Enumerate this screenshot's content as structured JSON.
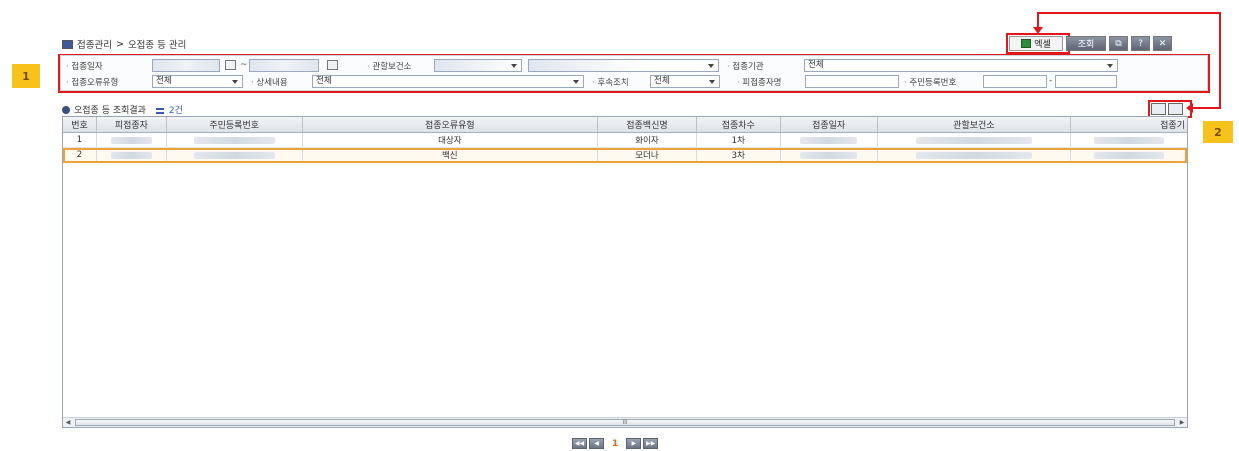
{
  "callouts": {
    "one": "1",
    "two": "2"
  },
  "breadcrumb": {
    "root": "접종관리",
    "separator": ">",
    "current": "오접종 등 관리"
  },
  "toolbar": {
    "excel_label": "엑셀",
    "search_label": "조회",
    "help_label": "?",
    "close_label": "✕",
    "popup_label": "⧉"
  },
  "filters": {
    "vaccination_date_label": "접종일자",
    "date_separator": "~",
    "health_center_label": "관할보건소",
    "institution_label": "접종기관",
    "institution_value": "전체",
    "error_type_label": "접종오류유형",
    "error_type_value": "전체",
    "detail_label": "상세내용",
    "detail_value": "전체",
    "followup_label": "후속조치",
    "followup_value": "전체",
    "recipient_label": "피접종자명",
    "rrn_label": "주민등록번호",
    "rrn_separator": "-"
  },
  "result": {
    "title": "오접종 등 조회결과",
    "count": "2건"
  },
  "grid": {
    "columns": [
      "번호",
      "피접종자",
      "주민등록번호",
      "접종오류유형",
      "접종백신명",
      "접종차수",
      "접종일자",
      "관할보건소",
      "접종기"
    ],
    "rows": [
      {
        "no": "1",
        "error_type": "대상자",
        "vaccine": "화이자",
        "dose": "1차"
      },
      {
        "no": "2",
        "error_type": "백신",
        "vaccine": "모더나",
        "dose": "3차"
      }
    ],
    "scroll_label": "III"
  },
  "pager": {
    "first": "◀◀",
    "prev": "◀",
    "page": "1",
    "next": "▶",
    "last": "▶▶"
  },
  "colors": {
    "callout": "#f7c21a",
    "highlight": "#e3161b",
    "selected_row": "#f0a23a"
  }
}
